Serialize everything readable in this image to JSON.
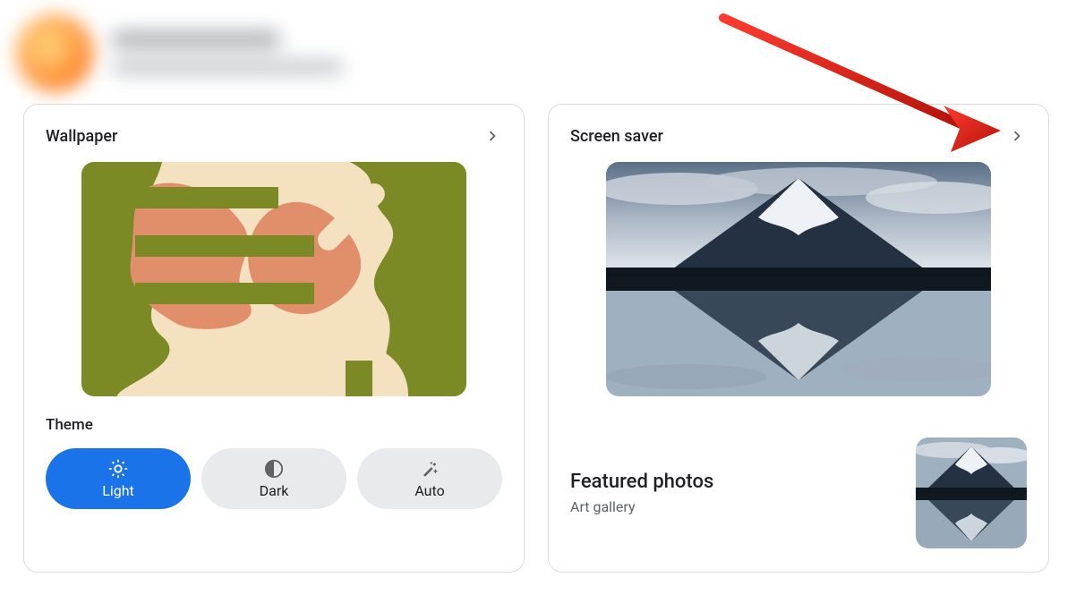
{
  "wallpaper": {
    "title": "Wallpaper",
    "theme_label": "Theme",
    "themes": {
      "light": "Light",
      "dark": "Dark",
      "auto": "Auto"
    },
    "selected_theme": "light"
  },
  "screensaver": {
    "title": "Screen saver",
    "featured_title": "Featured photos",
    "featured_subtitle": "Art gallery"
  },
  "colors": {
    "accent": "#1a73e8",
    "chip_bg": "#e8eaed",
    "arrow": "#d9241a"
  }
}
